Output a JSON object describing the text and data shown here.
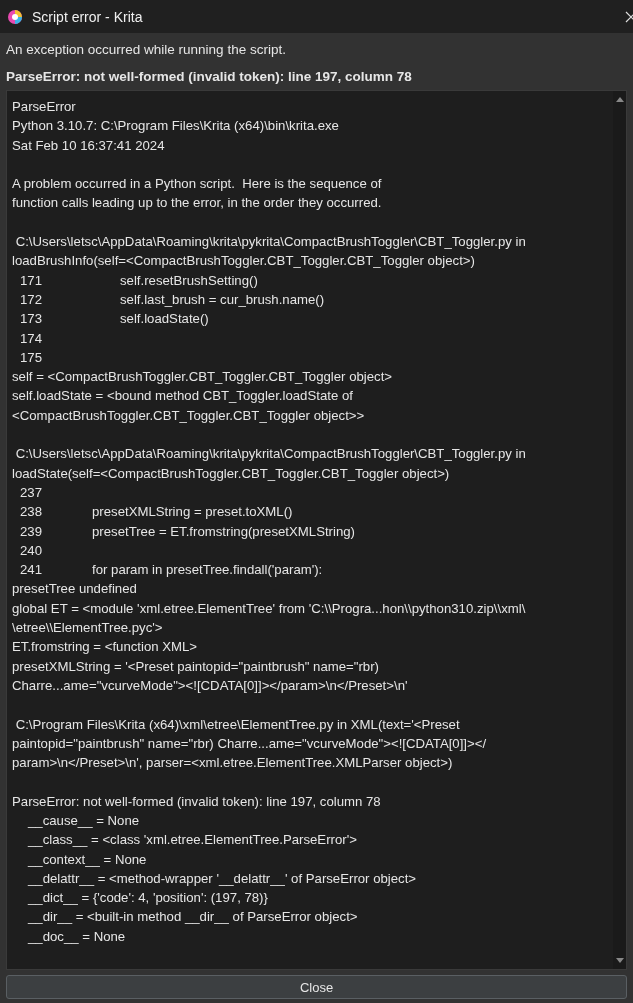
{
  "window": {
    "title": "Script error - Krita"
  },
  "message": "An exception occurred while running the script.",
  "error_summary": "ParseError: not well-formed (invalid token): line 197, column 78",
  "details": [
    {
      "lines": [
        {
          "text": "ParseError"
        },
        {
          "text": "Python 3.10.7: C:\\Program Files\\Krita (x64)\\bin\\krita.exe"
        },
        {
          "text": "Sat Feb 10 16:37:41 2024"
        }
      ]
    },
    {
      "lines": [
        {
          "text": "A problem occurred in a Python script.  Here is the sequence of"
        },
        {
          "text": "function calls leading up to the error, in the order they occurred."
        }
      ]
    },
    {
      "lines": [
        {
          "text": " C:\\Users\\letsc\\AppData\\Roaming\\krita\\pykrita\\CompactBrushToggler\\CBT_Toggler.py in"
        },
        {
          "text": "loadBrushInfo(self=<CompactBrushToggler.CBT_Toggler.CBT_Toggler object>)"
        },
        {
          "number": "171",
          "code": "self.resetBrushSetting()",
          "kind": "deep"
        },
        {
          "number": "172",
          "code": "self.last_brush = cur_brush.name()",
          "kind": "deep"
        },
        {
          "number": "173",
          "code": "self.loadState()",
          "kind": "deep"
        },
        {
          "number": "174"
        },
        {
          "number": "175"
        },
        {
          "text": "self = <CompactBrushToggler.CBT_Toggler.CBT_Toggler object>"
        },
        {
          "text": "self.loadState = <bound method CBT_Toggler.loadState of"
        },
        {
          "text": "<CompactBrushToggler.CBT_Toggler.CBT_Toggler object>>"
        }
      ]
    },
    {
      "lines": [
        {
          "text": " C:\\Users\\letsc\\AppData\\Roaming\\krita\\pykrita\\CompactBrushToggler\\CBT_Toggler.py in"
        },
        {
          "text": "loadState(self=<CompactBrushToggler.CBT_Toggler.CBT_Toggler object>)"
        },
        {
          "number": "237"
        },
        {
          "number": "238",
          "code": "presetXMLString = preset.toXML()",
          "kind": "shallow"
        },
        {
          "number": "239",
          "code": "presetTree = ET.fromstring(presetXMLString)",
          "kind": "shallow"
        },
        {
          "number": "240"
        },
        {
          "number": "241",
          "code": "for param in presetTree.findall('param'):",
          "kind": "shallow"
        },
        {
          "text": "presetTree undefined"
        },
        {
          "text": "global ET = <module 'xml.etree.ElementTree' from 'C:\\\\Progra...hon\\\\python310.zip\\\\xml\\"
        },
        {
          "text": "\\etree\\\\ElementTree.pyc'>"
        },
        {
          "text": "ET.fromstring = <function XML>"
        },
        {
          "text": "presetXMLString = '<Preset paintopid=\"paintbrush\" name=\"rbr)"
        },
        {
          "text": "Charre...ame=\"vcurveMode\"><![CDATA[0]]></param>\\n</Preset>\\n'"
        }
      ]
    },
    {
      "lines": [
        {
          "text": " C:\\Program Files\\Krita (x64)\\xml\\etree\\ElementTree.py in XML(text='<Preset"
        },
        {
          "text": "paintopid=\"paintbrush\" name=\"rbr) Charre...ame=\"vcurveMode\"><![CDATA[0]]></"
        },
        {
          "text": "param>\\n</Preset>\\n', parser=<xml.etree.ElementTree.XMLParser object>)"
        }
      ]
    },
    {
      "lines": [
        {
          "text": "ParseError: not well-formed (invalid token): line 197, column 78",
          "children": [
            {
              "text": "__cause__ = None"
            },
            {
              "text": "__class__ = <class 'xml.etree.ElementTree.ParseError'>"
            },
            {
              "text": "__context__ = None"
            },
            {
              "text": "__delattr__ = <method-wrapper '__delattr__' of ParseError object>"
            },
            {
              "text": "__dict__ = {'code': 4, 'position': (197, 78)}"
            },
            {
              "text": "__dir__ = <built-in method __dir__ of ParseError object>"
            },
            {
              "text": "__doc__ = None"
            }
          ]
        }
      ]
    }
  ],
  "buttons": [
    "Close"
  ]
}
